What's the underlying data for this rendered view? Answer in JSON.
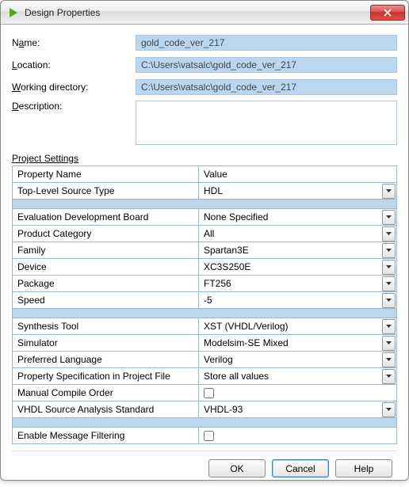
{
  "window": {
    "title": "Design Properties"
  },
  "fields": {
    "name_label_pre": "N",
    "name_label_u": "a",
    "name_label_post": "me:",
    "name_value": "gold_code_ver_217",
    "location_label_u": "L",
    "location_label_post": "ocation:",
    "location_value": "C:\\Users\\vatsalc\\gold_code_ver_217",
    "workdir_label_u": "W",
    "workdir_label_post": "orking directory:",
    "workdir_value": "C:\\Users\\vatsalc\\gold_code_ver_217",
    "desc_label_u": "D",
    "desc_label_post": "escription:",
    "desc_value": ""
  },
  "project_settings_label_u": "P",
  "project_settings_label_post": "roject Settings",
  "columns": {
    "name": "Property Name",
    "value": "Value"
  },
  "rows": {
    "top_level_source_type": {
      "name": "Top-Level Source Type",
      "value": "HDL",
      "dropdown": true
    },
    "eval_board": {
      "name": "Evaluation Development Board",
      "value": "None Specified",
      "dropdown": true
    },
    "product_category": {
      "name": "Product Category",
      "value": "All",
      "dropdown": true
    },
    "family": {
      "name": "Family",
      "value": "Spartan3E",
      "dropdown": true
    },
    "device": {
      "name": "Device",
      "value": "XC3S250E",
      "dropdown": true
    },
    "package": {
      "name": "Package",
      "value": "FT256",
      "dropdown": true
    },
    "speed": {
      "name": "Speed",
      "value": "-5",
      "dropdown": true
    },
    "synthesis_tool": {
      "name": "Synthesis Tool",
      "value": "XST (VHDL/Verilog)",
      "dropdown": true
    },
    "simulator": {
      "name": "Simulator",
      "value": "Modelsim-SE Mixed",
      "dropdown": true
    },
    "pref_lang": {
      "name": "Preferred Language",
      "value": "Verilog",
      "dropdown": true
    },
    "prop_spec": {
      "name": "Property Specification in Project File",
      "value": "Store all values",
      "dropdown": true
    },
    "manual_compile": {
      "name": "Manual Compile Order",
      "checked": false
    },
    "vhdl_std": {
      "name": "VHDL Source Analysis Standard",
      "value": "VHDL-93",
      "dropdown": true
    },
    "msg_filter": {
      "name": "Enable Message Filtering",
      "checked": false
    }
  },
  "buttons": {
    "ok": "OK",
    "cancel": "Cancel",
    "help": "Help"
  }
}
